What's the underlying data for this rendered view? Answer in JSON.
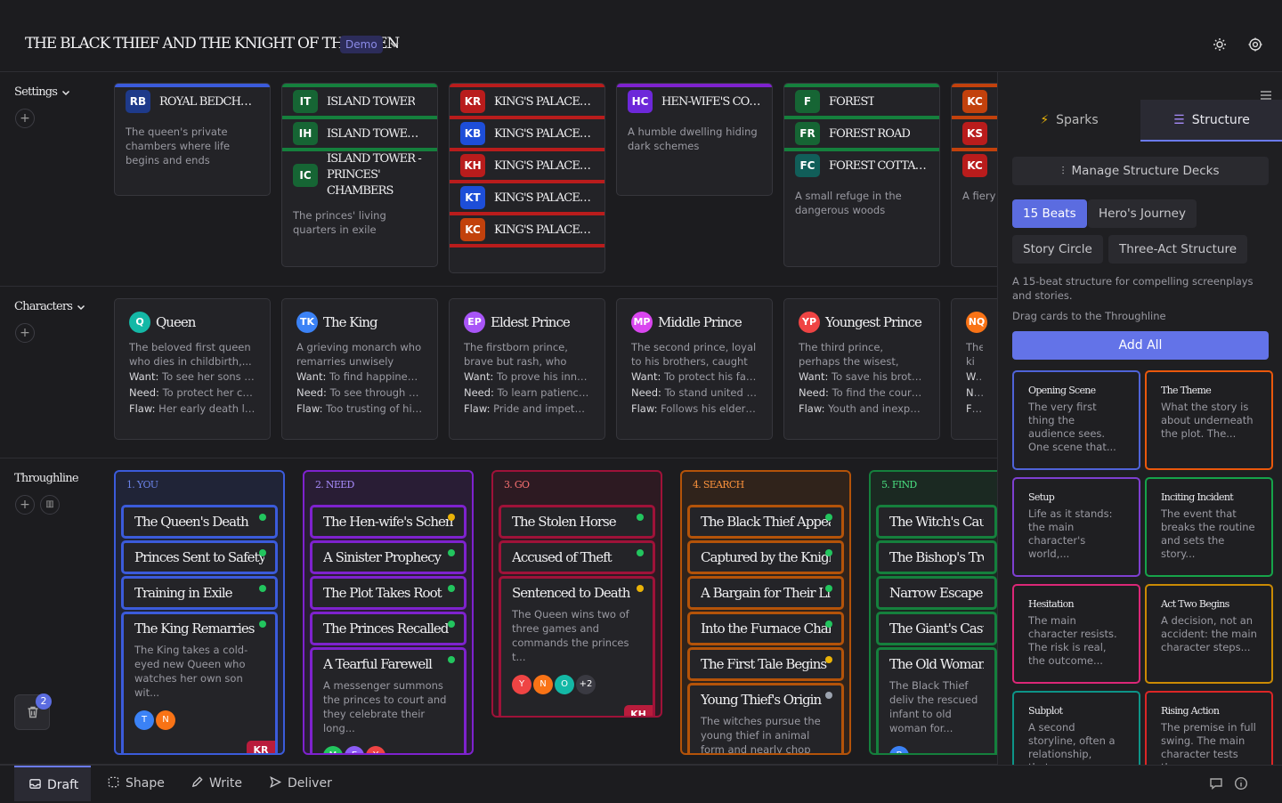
{
  "header": {
    "title": "THE BLACK THIEF AND THE KNIGHT OF THE GLEN",
    "badge": "Demo"
  },
  "lanes": {
    "settings": "Settings",
    "characters": "Characters",
    "throughline": "Throughline"
  },
  "settings_cards": [
    {
      "color": "#3b5bdb",
      "rows": [
        {
          "abbr": "RB",
          "title": "ROYAL BEDCHAMBER",
          "badge_color": "#1e3a8a"
        }
      ],
      "desc": "The queen's private chambers where life begins and ends"
    },
    {
      "color": "#15803d",
      "rows": [
        {
          "abbr": "IT",
          "title": "ISLAND TOWER",
          "badge_color": "#166534"
        },
        {
          "abbr": "IH",
          "title": "ISLAND TOWER - TRA...",
          "badge_color": "#166534"
        },
        {
          "abbr": "IC",
          "title": "ISLAND TOWER - PRINCES' CHAMBERS",
          "badge_color": "#166534"
        }
      ],
      "desc": "The princes' living quarters in exile"
    },
    {
      "color": "#b91c1c",
      "rows": [
        {
          "abbr": "KR",
          "title": "KING'S PALACE - TH...",
          "badge_color": "#b91c1c"
        },
        {
          "abbr": "KB",
          "title": "KING'S PALACE - ROY...",
          "badge_color": "#1d4ed8"
        },
        {
          "abbr": "KH",
          "title": "KING'S PALACE - GR...",
          "badge_color": "#b91c1c"
        },
        {
          "abbr": "KT",
          "title": "KING'S PALACE - TO...",
          "badge_color": "#1d4ed8"
        },
        {
          "abbr": "KC",
          "title": "KING'S PALACE - CO...",
          "badge_color": "#c2410c"
        }
      ],
      "desc": ""
    },
    {
      "color": "#7e22ce",
      "rows": [
        {
          "abbr": "HC",
          "title": "HEN-WIFE'S COTTAGE",
          "badge_color": "#6d28d9"
        }
      ],
      "desc": "A humble dwelling hiding dark schemes"
    },
    {
      "color": "#15803d",
      "rows": [
        {
          "abbr": "F",
          "title": "FOREST",
          "badge_color": "#166534"
        },
        {
          "abbr": "FR",
          "title": "FOREST ROAD",
          "badge_color": "#166534"
        },
        {
          "abbr": "FC",
          "title": "FOREST COTTAGE",
          "badge_color": "#115e59"
        }
      ],
      "desc": "A small refuge in the dangerous woods"
    },
    {
      "color": "#c2410c",
      "rows": [
        {
          "abbr": "KC",
          "title": "",
          "badge_color": "#c2410c"
        },
        {
          "abbr": "KS",
          "title": "",
          "badge_color": "#b91c1c"
        },
        {
          "abbr": "KC",
          "title": "",
          "badge_color": "#b91c1c"
        }
      ],
      "desc": "A fiery served"
    }
  ],
  "characters": [
    {
      "abbr": "Q",
      "name": "Queen",
      "color": "#14b8a6",
      "desc": "The beloved first queen who dies in childbirth,...",
      "want": "To see her sons gr...",
      "need": "To protect her chi...",
      "flaw": "Her early death lea..."
    },
    {
      "abbr": "TK",
      "name": "The King",
      "color": "#3b82f6",
      "desc": "A grieving monarch who remarries unwisely and...",
      "want": "To find happiness...",
      "need": "To see through de...",
      "flaw": "Too trusting of his ..."
    },
    {
      "abbr": "EP",
      "name": "Eldest Prince",
      "color": "#a855f7",
      "desc": "The firstborn prince, brave but rash, who fac...",
      "want": "To prove his innoc...",
      "need": "To learn patience ...",
      "flaw": "Pride and impetuo..."
    },
    {
      "abbr": "MP",
      "name": "Middle Prince",
      "color": "#d946ef",
      "desc": "The second prince, loyal to his brothers, caught i...",
      "want": "To protect his fam...",
      "need": "To stand united w...",
      "flaw": "Follows his elder b..."
    },
    {
      "abbr": "YP",
      "name": "Youngest Prince",
      "color": "#ef4444",
      "desc": "The third prince, perhaps the wisest, who...",
      "want": "To save his brothe...",
      "need": "To find the courag...",
      "flaw": "Youth and inexperi..."
    },
    {
      "abbr": "NQ",
      "name": "",
      "color": "#f97316",
      "desc": "The ki who co",
      "want": "",
      "need": "",
      "flaw": ""
    }
  ],
  "char_labels": {
    "want": "Want:",
    "need": "Need:",
    "flaw": "Flaw:"
  },
  "throughline": [
    {
      "title": "1. YOU",
      "color": "#3b5bdb",
      "title_color": "#6b83e8",
      "beats": [
        {
          "title": "The Queen's Death",
          "dot": "#22c55e"
        },
        {
          "title": "Princes Sent to Safety",
          "dot": "#22c55e"
        },
        {
          "title": "Training in Exile",
          "dot": "#22c55e"
        },
        {
          "title": "The King Remarries",
          "dot": "#22c55e",
          "desc": "The King takes a cold-eyed new Queen who watches her own son wit...",
          "avatars": [
            {
              "l": "T",
              "c": "#3b82f6"
            },
            {
              "l": "N",
              "c": "#f97316"
            }
          ],
          "tag": "KR"
        }
      ]
    },
    {
      "title": "2. NEED",
      "color": "#7e22ce",
      "title_color": "#a78bfa",
      "beats": [
        {
          "title": "The Hen-wife's Scheme",
          "dot": "#eab308"
        },
        {
          "title": "A Sinister Prophecy",
          "dot": "#22c55e"
        },
        {
          "title": "The Plot Takes Root",
          "dot": "#22c55e"
        },
        {
          "title": "The Princes Recalled",
          "dot": "#22c55e"
        },
        {
          "title": "A Tearful Farewell",
          "dot": "#22c55e",
          "desc": "A messenger summons the princes to court and they celebrate their long...",
          "avatars": [
            {
              "l": "M",
              "c": "#22c55e"
            },
            {
              "l": "E",
              "c": "#8b5cf6"
            },
            {
              "l": "Y",
              "c": "#ef4444"
            }
          ]
        }
      ]
    },
    {
      "title": "3. GO",
      "color": "#9f1239",
      "title_color": "#f87171",
      "beats": [
        {
          "title": "The Stolen Horse",
          "dot": "#22c55e"
        },
        {
          "title": "Accused of Theft",
          "dot": "#22c55e"
        },
        {
          "title": "Sentenced to Death",
          "dot": "#eab308",
          "desc": "The Queen wins two of three games and commands the princes t...",
          "avatars": [
            {
              "l": "Y",
              "c": "#ef4444"
            },
            {
              "l": "N",
              "c": "#f97316"
            },
            {
              "l": "O",
              "c": "#14b8a6"
            },
            {
              "l": "+2",
              "c": "#3a3a42"
            }
          ],
          "tag": "KH"
        }
      ]
    },
    {
      "title": "4. SEARCH",
      "color": "#b45309",
      "title_color": "#fb923c",
      "beats": [
        {
          "title": "The Black Thief Appears",
          "dot": "#22c55e"
        },
        {
          "title": "Captured by the Knight",
          "dot": "#22c55e"
        },
        {
          "title": "A Bargain for Their Lives",
          "dot": "#22c55e"
        },
        {
          "title": "Into the Furnace Chamber",
          "dot": "#22c55e"
        },
        {
          "title": "The First Tale Begins",
          "dot": "#eab308"
        },
        {
          "title": "Young Thief's Origin",
          "dot": "#9ca3af",
          "desc": "The witches pursue the young thief in animal form and nearly chop down hi..."
        }
      ]
    },
    {
      "title": "5. FIND",
      "color": "#15803d",
      "title_color": "#4ade80",
      "beats": [
        {
          "title": "The Witch's Cauldron"
        },
        {
          "title": "The Bishop's Treasure"
        },
        {
          "title": "Narrow Escape"
        },
        {
          "title": "The Giant's Castle"
        },
        {
          "title": "The Old Woman's Aid",
          "desc": "The Black Thief deliv the rescued infant to old woman for...",
          "avatars": [
            {
              "l": "B",
              "c": "#3b82f6"
            }
          ]
        }
      ]
    }
  ],
  "trash_count": "2",
  "panel": {
    "tabs": [
      "Sparks",
      "Structure"
    ],
    "manage_label": "Manage Structure Decks",
    "chips": [
      "15 Beats",
      "Hero's Journey",
      "Story Circle",
      "Three-Act Structure"
    ],
    "description": "A 15-beat structure for compelling screenplays and stories.",
    "drag_hint": "Drag cards to the Throughline",
    "add_all": "Add All",
    "cards": [
      {
        "title": "Opening Scene",
        "desc": "The very first thing the audience sees. One scene that...",
        "color": "#4f63d8"
      },
      {
        "title": "The Theme",
        "desc": "What the story is about underneath the plot. The...",
        "color": "#ea580c"
      },
      {
        "title": "Setup",
        "desc": "Life as it stands: the main character's world,...",
        "color": "#7e3fd0"
      },
      {
        "title": "Inciting Incident",
        "desc": "The event that breaks the routine and sets the story...",
        "color": "#16a34a"
      },
      {
        "title": "Hesitation",
        "desc": "The main character resists. The risk is real, the outcome...",
        "color": "#db2777"
      },
      {
        "title": "Act Two Begins",
        "desc": "A decision, not an accident: the main character steps...",
        "color": "#ca8a04"
      },
      {
        "title": "Subplot",
        "desc": "A second storyline, often a relationship, that...",
        "color": "#0d9488"
      },
      {
        "title": "Rising Action",
        "desc": "The premise in full swing. The main character tests th...",
        "color": "#dc2626"
      }
    ]
  },
  "bottom_tabs": [
    "Draft",
    "Shape",
    "Write",
    "Deliver"
  ]
}
